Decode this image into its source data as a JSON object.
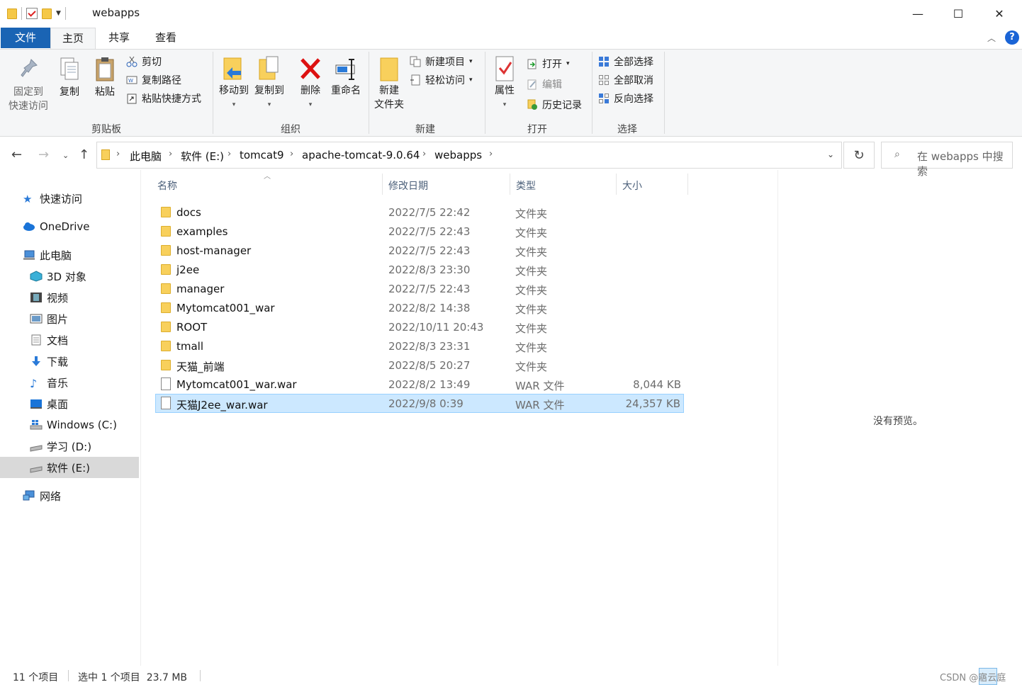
{
  "window": {
    "title": "webapps",
    "minimize": "—",
    "maximize": "☐",
    "close": "✕"
  },
  "tabs": [
    "文件",
    "主页",
    "共享",
    "查看"
  ],
  "ribbon": {
    "clipboard": {
      "group_label": "剪贴板",
      "pin_line1": "固定到",
      "pin_line2": "快速访问",
      "copy": "复制",
      "paste": "粘贴",
      "cut": "剪切",
      "copy_path": "复制路径",
      "paste_shortcut": "粘贴快捷方式"
    },
    "organize": {
      "group_label": "组织",
      "move_to": "移动到",
      "copy_to": "复制到",
      "delete": "删除",
      "rename": "重命名"
    },
    "new": {
      "group_label": "新建",
      "new_folder_line1": "新建",
      "new_folder_line2": "文件夹",
      "new_item": "新建项目",
      "easy_access": "轻松访问"
    },
    "open": {
      "group_label": "打开",
      "properties": "属性",
      "open": "打开",
      "edit": "编辑",
      "history": "历史记录"
    },
    "select": {
      "group_label": "选择",
      "select_all": "全部选择",
      "select_none": "全部取消",
      "invert": "反向选择"
    }
  },
  "address": {
    "crumbs": [
      "此电脑",
      "软件 (E:)",
      "tomcat9",
      "apache-tomcat-9.0.64",
      "webapps"
    ]
  },
  "search": {
    "placeholder": "在 webapps 中搜索"
  },
  "sidebar": {
    "items": [
      {
        "label": "快速访问",
        "icon": "star-icon"
      },
      {
        "label": "OneDrive",
        "icon": "cloud-icon"
      },
      {
        "label": "此电脑",
        "icon": "computer-icon"
      },
      {
        "label": "3D 对象",
        "icon": "cube-icon"
      },
      {
        "label": "视频",
        "icon": "film-icon"
      },
      {
        "label": "图片",
        "icon": "picture-icon"
      },
      {
        "label": "文档",
        "icon": "document-icon"
      },
      {
        "label": "下载",
        "icon": "download-icon"
      },
      {
        "label": "音乐",
        "icon": "music-icon"
      },
      {
        "label": "桌面",
        "icon": "desktop-icon"
      },
      {
        "label": "Windows (C:)",
        "icon": "drive-icon"
      },
      {
        "label": "学习 (D:)",
        "icon": "drive-icon"
      },
      {
        "label": "软件 (E:)",
        "icon": "drive-icon"
      },
      {
        "label": "网络",
        "icon": "network-icon"
      }
    ]
  },
  "columns": {
    "name": "名称",
    "date": "修改日期",
    "type": "类型",
    "size": "大小"
  },
  "files": [
    {
      "name": "docs",
      "date": "2022/7/5 22:42",
      "type": "文件夹",
      "size": ""
    },
    {
      "name": "examples",
      "date": "2022/7/5 22:43",
      "type": "文件夹",
      "size": ""
    },
    {
      "name": "host-manager",
      "date": "2022/7/5 22:43",
      "type": "文件夹",
      "size": ""
    },
    {
      "name": "j2ee",
      "date": "2022/8/3 23:30",
      "type": "文件夹",
      "size": ""
    },
    {
      "name": "manager",
      "date": "2022/7/5 22:43",
      "type": "文件夹",
      "size": ""
    },
    {
      "name": "Mytomcat001_war",
      "date": "2022/8/2 14:38",
      "type": "文件夹",
      "size": ""
    },
    {
      "name": "ROOT",
      "date": "2022/10/11 20:43",
      "type": "文件夹",
      "size": ""
    },
    {
      "name": "tmall",
      "date": "2022/8/3 23:31",
      "type": "文件夹",
      "size": ""
    },
    {
      "name": "天猫_前端",
      "date": "2022/8/5 20:27",
      "type": "文件夹",
      "size": ""
    },
    {
      "name": "Mytomcat001_war.war",
      "date": "2022/8/2 13:49",
      "type": "WAR 文件",
      "size": "8,044 KB"
    },
    {
      "name": "天猫J2ee_war.war",
      "date": "2022/9/8 0:39",
      "type": "WAR 文件",
      "size": "24,357 KB"
    }
  ],
  "preview": {
    "text": "没有预览。"
  },
  "status": {
    "count": "11 个项目",
    "selection": "选中 1 个项目  23.7 MB"
  },
  "watermark": "CSDN @寤云庭"
}
